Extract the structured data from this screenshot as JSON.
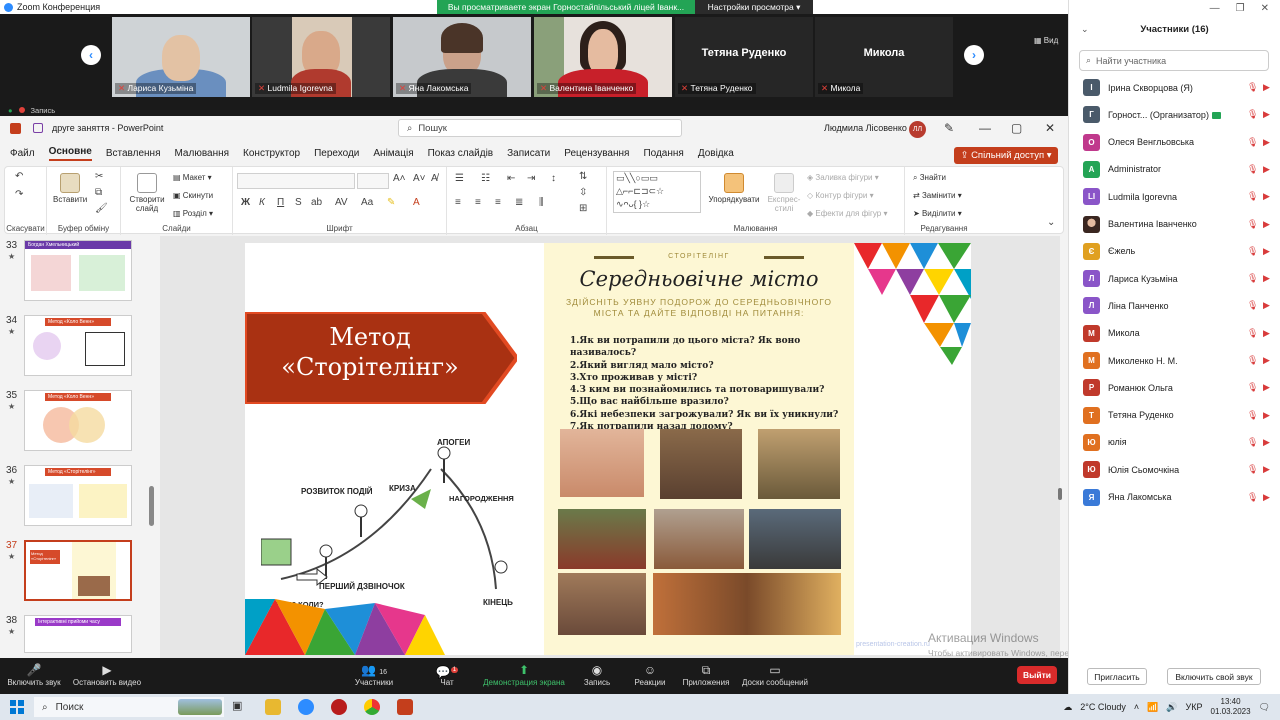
{
  "zoom": {
    "app_title": "Zoom Конференция",
    "share_banner_text": "Вы просматриваете экран Горностайпільський ліцей Іванк...",
    "view_settings_label": "Настройки просмотра",
    "view_label": "Вид",
    "record_label": "Запись",
    "gallery": [
      {
        "name": "Лариса Кузьміна",
        "type": "video"
      },
      {
        "name": "Ludmila Igorevna",
        "type": "video"
      },
      {
        "name": "Яна Лакомська",
        "type": "video"
      },
      {
        "name": "Валентина Іванченко",
        "type": "video"
      },
      {
        "name": "Тетяна Руденко",
        "big": "Тетяна Руденко",
        "type": "name"
      },
      {
        "name": "Микола",
        "big": "Микола",
        "type": "name"
      }
    ],
    "bottom_bar": {
      "mute": "Включить звук",
      "video": "Остановить видео",
      "participants": "Участники",
      "participants_count": "16",
      "chat": "Чат",
      "chat_badge": "1",
      "share": "Демонстрация экрана",
      "record": "Запись",
      "reactions": "Реакции",
      "apps": "Приложения",
      "boards": "Доски сообщений",
      "leave": "Выйти"
    }
  },
  "powerpoint": {
    "title": "друге заняття  -  PowerPoint",
    "search_placeholder": "Пошук",
    "user_name": "Людмила Лісовенко",
    "user_initials": "ЛЛ",
    "share_button": "Спільний доступ",
    "menu": [
      "Файл",
      "Основне",
      "Вставлення",
      "Малювання",
      "Конструктор",
      "Переходи",
      "Анімація",
      "Показ слайдів",
      "Записати",
      "Рецензування",
      "Подання",
      "Довідка"
    ],
    "active_tab": "Основне",
    "ribbon": {
      "undo_group": "Скасувати",
      "paste": "Вставити",
      "clipboard_group": "Буфер обміну",
      "new_slide": "Створити слайд",
      "layout": "Макет",
      "reset": "Скинути",
      "sections": "Розділ",
      "slides_group": "Слайди",
      "font_group": "Шрифт",
      "paragraph_group": "Абзац",
      "arrange": "Упорядкувати",
      "quick_styles": "Експрес-стилі",
      "shape_fill": "Заливка фігури",
      "shape_outline": "Контур фігури",
      "shape_effects": "Ефекти для фігур",
      "drawing_group": "Малювання",
      "find": "Знайти",
      "replace": "Замінити",
      "select": "Виділити",
      "editing_group": "Редагування",
      "bold": "Ж",
      "italic": "К",
      "underline": "П",
      "strike": "S"
    },
    "thumbnails": [
      {
        "num": "33",
        "title": "Богдан Хмельницький"
      },
      {
        "num": "34",
        "title": "Метод «Коло Венн»"
      },
      {
        "num": "35",
        "title": "Метод «Коло Венн»"
      },
      {
        "num": "36",
        "title": "Метод «Сторітелінг»"
      },
      {
        "num": "37",
        "title": "Метод «Сторітелінг»",
        "selected": true
      },
      {
        "num": "38",
        "title": "Інтерактивні прийоми часу"
      }
    ],
    "slide": {
      "method_line1": "Метод",
      "method_line2": "«Сторітелінг»",
      "story_labels": [
        "АПОГЕЙ",
        "РОЗВИТОК ПОДІЙ",
        "КРИЗА",
        "НАГОРОДЖЕННЯ (ВИСНОВКИ)",
        "ПЕРШИЙ ДЗВІНОЧОК",
        "ЩО? ДЕ? КОЛИ?",
        "КІНЕЦЬ"
      ],
      "panel_tag": "СТОРІТЕЛІНГ",
      "panel_title": "Середньовічне місто",
      "panel_subtitle": "ЗДІЙСНІТЬ УЯВНУ ПОДОРОЖ ДО СЕРЕДНЬОВІЧНОГО МІСТА ТА ДАЙТЕ ВІДПОВІДІ НА ПИТАННЯ:",
      "questions": [
        "1.Як ви потрапили до цього міста? Як воно називалось?",
        "2.Який вигляд мало місто?",
        "3.Хто проживав у місті?",
        "4.З ким ви познайомились та потоваришували?",
        "5.Що вас найбільше вразило?",
        "6.Які небезпеки загрожували? Як ви їх уникнули?",
        "7.Як потрапили назад додому?"
      ],
      "watermark": "presentation-creation.ru"
    },
    "activate_windows": "Активация Windows",
    "activate_windows_sub": "Чтобы активировать Windows, перейдите в раздел \"Параметры\"."
  },
  "participants_panel": {
    "title": "Участники (16)",
    "search_placeholder": "Найти участника",
    "invite": "Пригласить",
    "unmute_me": "Включить свой звук",
    "list": [
      {
        "initial": "І",
        "name": "Ірина Скворцова (Я)",
        "color": "#4a5a6a"
      },
      {
        "initial": "Г",
        "name": "Горност...  (Организатор)",
        "color": "#4a5a6a",
        "host": true
      },
      {
        "initial": "О",
        "name": "Олеся Венгльовська",
        "color": "#c0398c"
      },
      {
        "initial": "A",
        "name": "Administrator",
        "color": "#23a455"
      },
      {
        "initial": "LI",
        "name": "Ludmila Igorevna",
        "color": "#8a55c8"
      },
      {
        "initial": "",
        "name": "Валентина Іванченко",
        "color": "#8a4a3a",
        "photo": true
      },
      {
        "initial": "Є",
        "name": "Єжель",
        "color": "#e0a020"
      },
      {
        "initial": "Л",
        "name": "Лариса Кузьміна",
        "color": "#8a55c8"
      },
      {
        "initial": "Л",
        "name": "Ліна Панченко",
        "color": "#8a55c8"
      },
      {
        "initial": "М",
        "name": "Микола",
        "color": "#c0392b"
      },
      {
        "initial": "М",
        "name": "Миколенко Н. М.",
        "color": "#e07020"
      },
      {
        "initial": "Р",
        "name": "Романюк Ольга",
        "color": "#c0392b"
      },
      {
        "initial": "Т",
        "name": "Тетяна Руденко",
        "color": "#e07020"
      },
      {
        "initial": "Ю",
        "name": "юлія",
        "color": "#e07020"
      },
      {
        "initial": "Ю",
        "name": "Юлія Сьомочкіна",
        "color": "#c0392b"
      },
      {
        "initial": "Я",
        "name": "Яна Лакомська",
        "color": "#3a7ad8"
      }
    ]
  },
  "taskbar": {
    "search": "Поиск",
    "weather": "2°C  Cloudy",
    "lang": "УКР",
    "time": "13:40",
    "date": "01.03.2023"
  }
}
